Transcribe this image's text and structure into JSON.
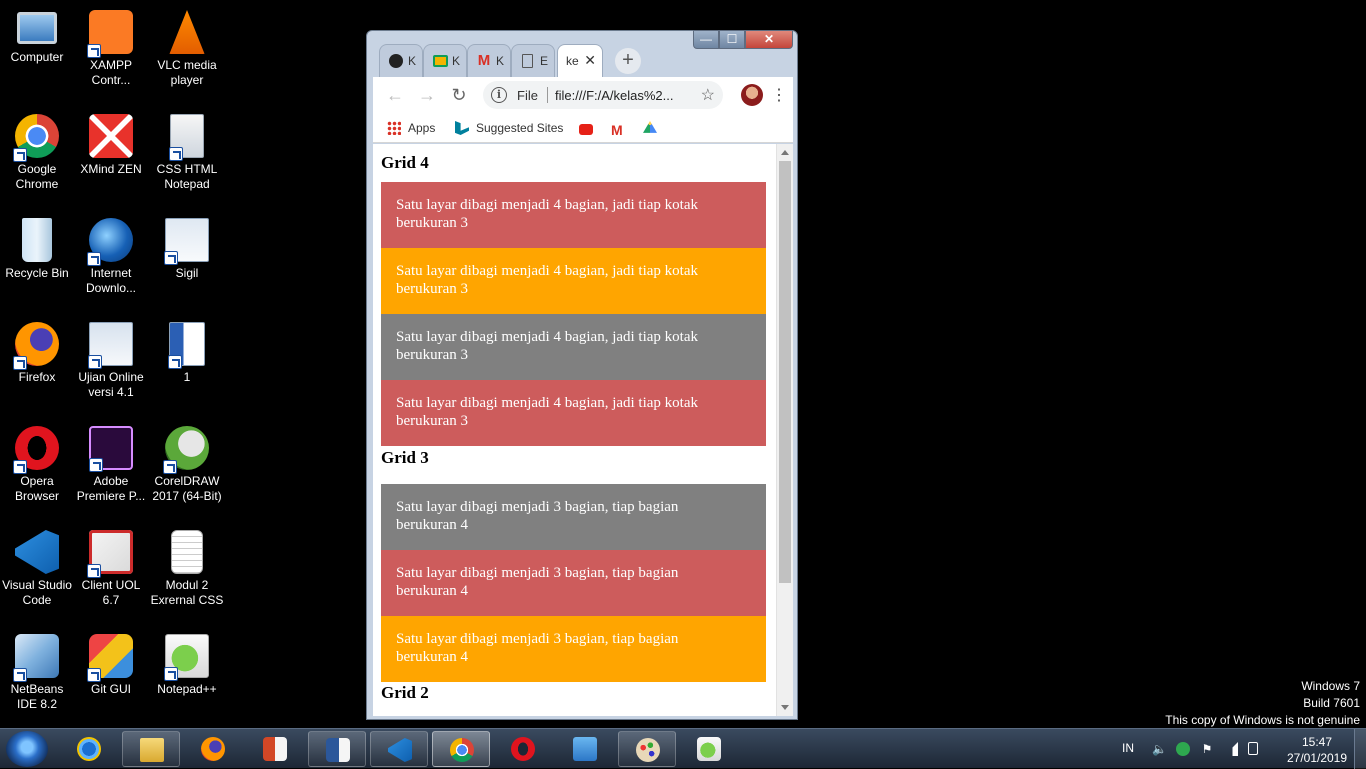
{
  "desktop": {
    "icons": [
      {
        "label": "Computer"
      },
      {
        "label": "XAMPP Contr..."
      },
      {
        "label": "VLC media player"
      },
      {
        "label": "Google Chrome"
      },
      {
        "label": "XMind ZEN"
      },
      {
        "label": "CSS HTML Notepad"
      },
      {
        "label": "Recycle Bin"
      },
      {
        "label": "Internet Downlo..."
      },
      {
        "label": "Sigil"
      },
      {
        "label": "Firefox"
      },
      {
        "label": "Ujian Online versi 4.1"
      },
      {
        "label": "1"
      },
      {
        "label": "Opera Browser"
      },
      {
        "label": "Adobe Premiere P..."
      },
      {
        "label": "CorelDRAW 2017 (64-Bit)"
      },
      {
        "label": "Visual Studio Code"
      },
      {
        "label": "Client UOL 6.7"
      },
      {
        "label": "Modul 2 Exrernal CSS"
      },
      {
        "label": "NetBeans IDE 8.2"
      },
      {
        "label": "Git GUI"
      },
      {
        "label": "Notepad++"
      }
    ],
    "watermark": {
      "line1": "Windows 7",
      "line2": "Build 7601",
      "line3": "This copy of Windows is not genuine"
    }
  },
  "browser": {
    "tabs": [
      {
        "icon": "github-icon",
        "title": "K"
      },
      {
        "icon": "classroom-icon",
        "title": "K"
      },
      {
        "icon": "gmail-icon",
        "title": "K"
      },
      {
        "icon": "document-icon",
        "title": "E"
      },
      {
        "icon": "",
        "title": "ke",
        "active": true
      }
    ],
    "new_tab": "+",
    "window_controls": {
      "minimize": "—",
      "maximize": "☐",
      "close": "✕"
    },
    "omnibox": {
      "scheme_label": "File",
      "url": "file:///F:/A/kelas%2..."
    },
    "bookmarks": [
      {
        "icon": "apps-grid-icon",
        "label": "Apps"
      },
      {
        "icon": "bing-icon",
        "label": "Suggested Sites"
      },
      {
        "icon": "youtube-icon",
        "label": ""
      },
      {
        "icon": "gmail-icon",
        "label": ""
      },
      {
        "icon": "drive-icon",
        "label": ""
      }
    ]
  },
  "page": {
    "grid4": {
      "heading": "Grid 4",
      "boxes": [
        {
          "text": "Satu layar dibagi menjadi 4 bagian, jadi tiap kotak berukuran 3",
          "color": "#cd5c5c"
        },
        {
          "text": "Satu layar dibagi menjadi 4 bagian, jadi tiap kotak berukuran 3",
          "color": "#ffa500"
        },
        {
          "text": "Satu layar dibagi menjadi 4 bagian, jadi tiap kotak berukuran 3",
          "color": "#808080"
        },
        {
          "text": "Satu layar dibagi menjadi 4 bagian, jadi tiap kotak berukuran 3",
          "color": "#cd5c5c"
        }
      ]
    },
    "grid3": {
      "heading": "Grid 3",
      "boxes": [
        {
          "text": "Satu layar dibagi menjadi 3 bagian, tiap bagian berukuran 4",
          "color": "#808080"
        },
        {
          "text": "Satu layar dibagi menjadi 3 bagian, tiap bagian berukuran 4",
          "color": "#cd5c5c"
        },
        {
          "text": "Satu layar dibagi menjadi 3 bagian, tiap bagian berukuran 4",
          "color": "#ffa500"
        }
      ]
    },
    "grid2": {
      "heading": "Grid 2"
    }
  },
  "taskbar": {
    "items": [
      {
        "name": "internet-explorer"
      },
      {
        "name": "file-explorer"
      },
      {
        "name": "firefox"
      },
      {
        "name": "powerpoint"
      },
      {
        "name": "word"
      },
      {
        "name": "visual-studio-code"
      },
      {
        "name": "google-chrome",
        "active": true
      },
      {
        "name": "opera"
      },
      {
        "name": "media-player"
      },
      {
        "name": "paint"
      },
      {
        "name": "notepad-plus-plus"
      }
    ],
    "tray": {
      "language": "IN",
      "time": "15:47",
      "date": "27/01/2019"
    }
  }
}
